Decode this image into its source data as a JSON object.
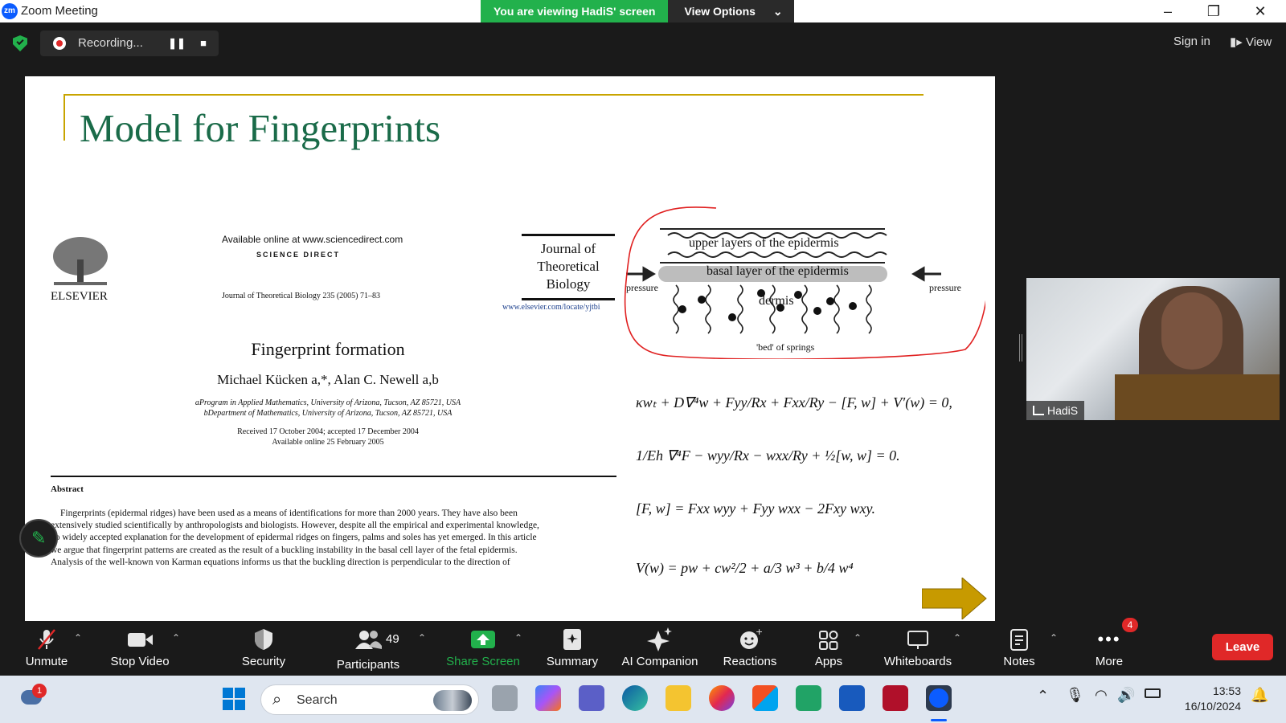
{
  "window": {
    "app_title": "Zoom Meeting",
    "logo_text": "zm"
  },
  "banner": {
    "viewing_text": "You are viewing HadiS' screen",
    "view_options": "View Options"
  },
  "topbar": {
    "recording_text": "Recording...",
    "sign_in": "Sign in",
    "view": "View"
  },
  "slide": {
    "title": "Model for Fingerprints",
    "elsevier": "ELSEVIER",
    "available_online": "Available online at www.sciencedirect.com",
    "science_direct": "SCIENCE DIRECT",
    "journal_citation": "Journal of Theoretical Biology 235 (2005) 71–83",
    "journal_name": "Journal of Theoretical Biology",
    "journal_url": "www.elsevier.com/locate/yjtbi",
    "paper_title": "Fingerprint formation",
    "authors": "Michael Kücken a,*, Alan C. Newell a,b",
    "affil_a": "aProgram in Applied Mathematics, University of Arizona, Tucson, AZ 85721, USA",
    "affil_b": "bDepartment of Mathematics, University of Arizona, Tucson, AZ 85721, USA",
    "received": "Received 17 October 2004; accepted 17 December 2004",
    "available_date": "Available online 25 February 2005",
    "abstract_heading": "Abstract",
    "abstract_lines": [
      "Fingerprints (epidermal ridges) have been used as a means of identifications for more than 2000 years. They have also been",
      "extensively studied scientifically by anthropologists and biologists. However, despite all the empirical and experimental knowledge,",
      "no widely accepted explanation for the development of epidermal ridges on fingers, palms and soles has yet emerged. In this article",
      "we argue that fingerprint patterns are created as the result of a buckling instability in the basal cell layer of the fetal epidermis.",
      "Analysis of the well-known von Karman equations informs us that the buckling direction is perpendicular to the direction of"
    ],
    "diagram": {
      "upper_layers": "upper layers of the epidermis",
      "basal_layer": "basal layer of the epidermis",
      "dermis": "dermis",
      "pressure_left": "pressure",
      "pressure_right": "pressure",
      "springs": "'bed' of springs"
    },
    "equations": [
      "κwₜ + D∇⁴w + Fyy/Rx + Fxx/Ry − [F, w] + V′(w) = 0,",
      "1/Eh ∇⁴F − wyy/Rx − wxx/Ry + ½[w, w] = 0.",
      "[F, w] = Fxx wyy + Fyy wxx − 2Fxy wxy.",
      "V(w) = pw + cw²/2 + a/3 w³ + b/4 w⁴"
    ]
  },
  "video": {
    "participant_name": "HadiS"
  },
  "toolbar": {
    "unmute": "Unmute",
    "stop_video": "Stop Video",
    "security": "Security",
    "participants": "Participants",
    "participants_count": "49",
    "share_screen": "Share Screen",
    "summary": "Summary",
    "ai_companion": "AI Companion",
    "reactions": "Reactions",
    "apps": "Apps",
    "whiteboards": "Whiteboards",
    "notes": "Notes",
    "more": "More",
    "more_badge": "4",
    "leave": "Leave"
  },
  "taskbar": {
    "search_placeholder": "Search",
    "notification_badge": "1",
    "time": "13:53",
    "date": "16/10/2024"
  },
  "colors": {
    "zoom_blue": "#0b5cff",
    "green": "#22b14c",
    "leave_red": "#e02828",
    "slide_title": "#1a6b49",
    "annotation_red": "#e02020"
  }
}
